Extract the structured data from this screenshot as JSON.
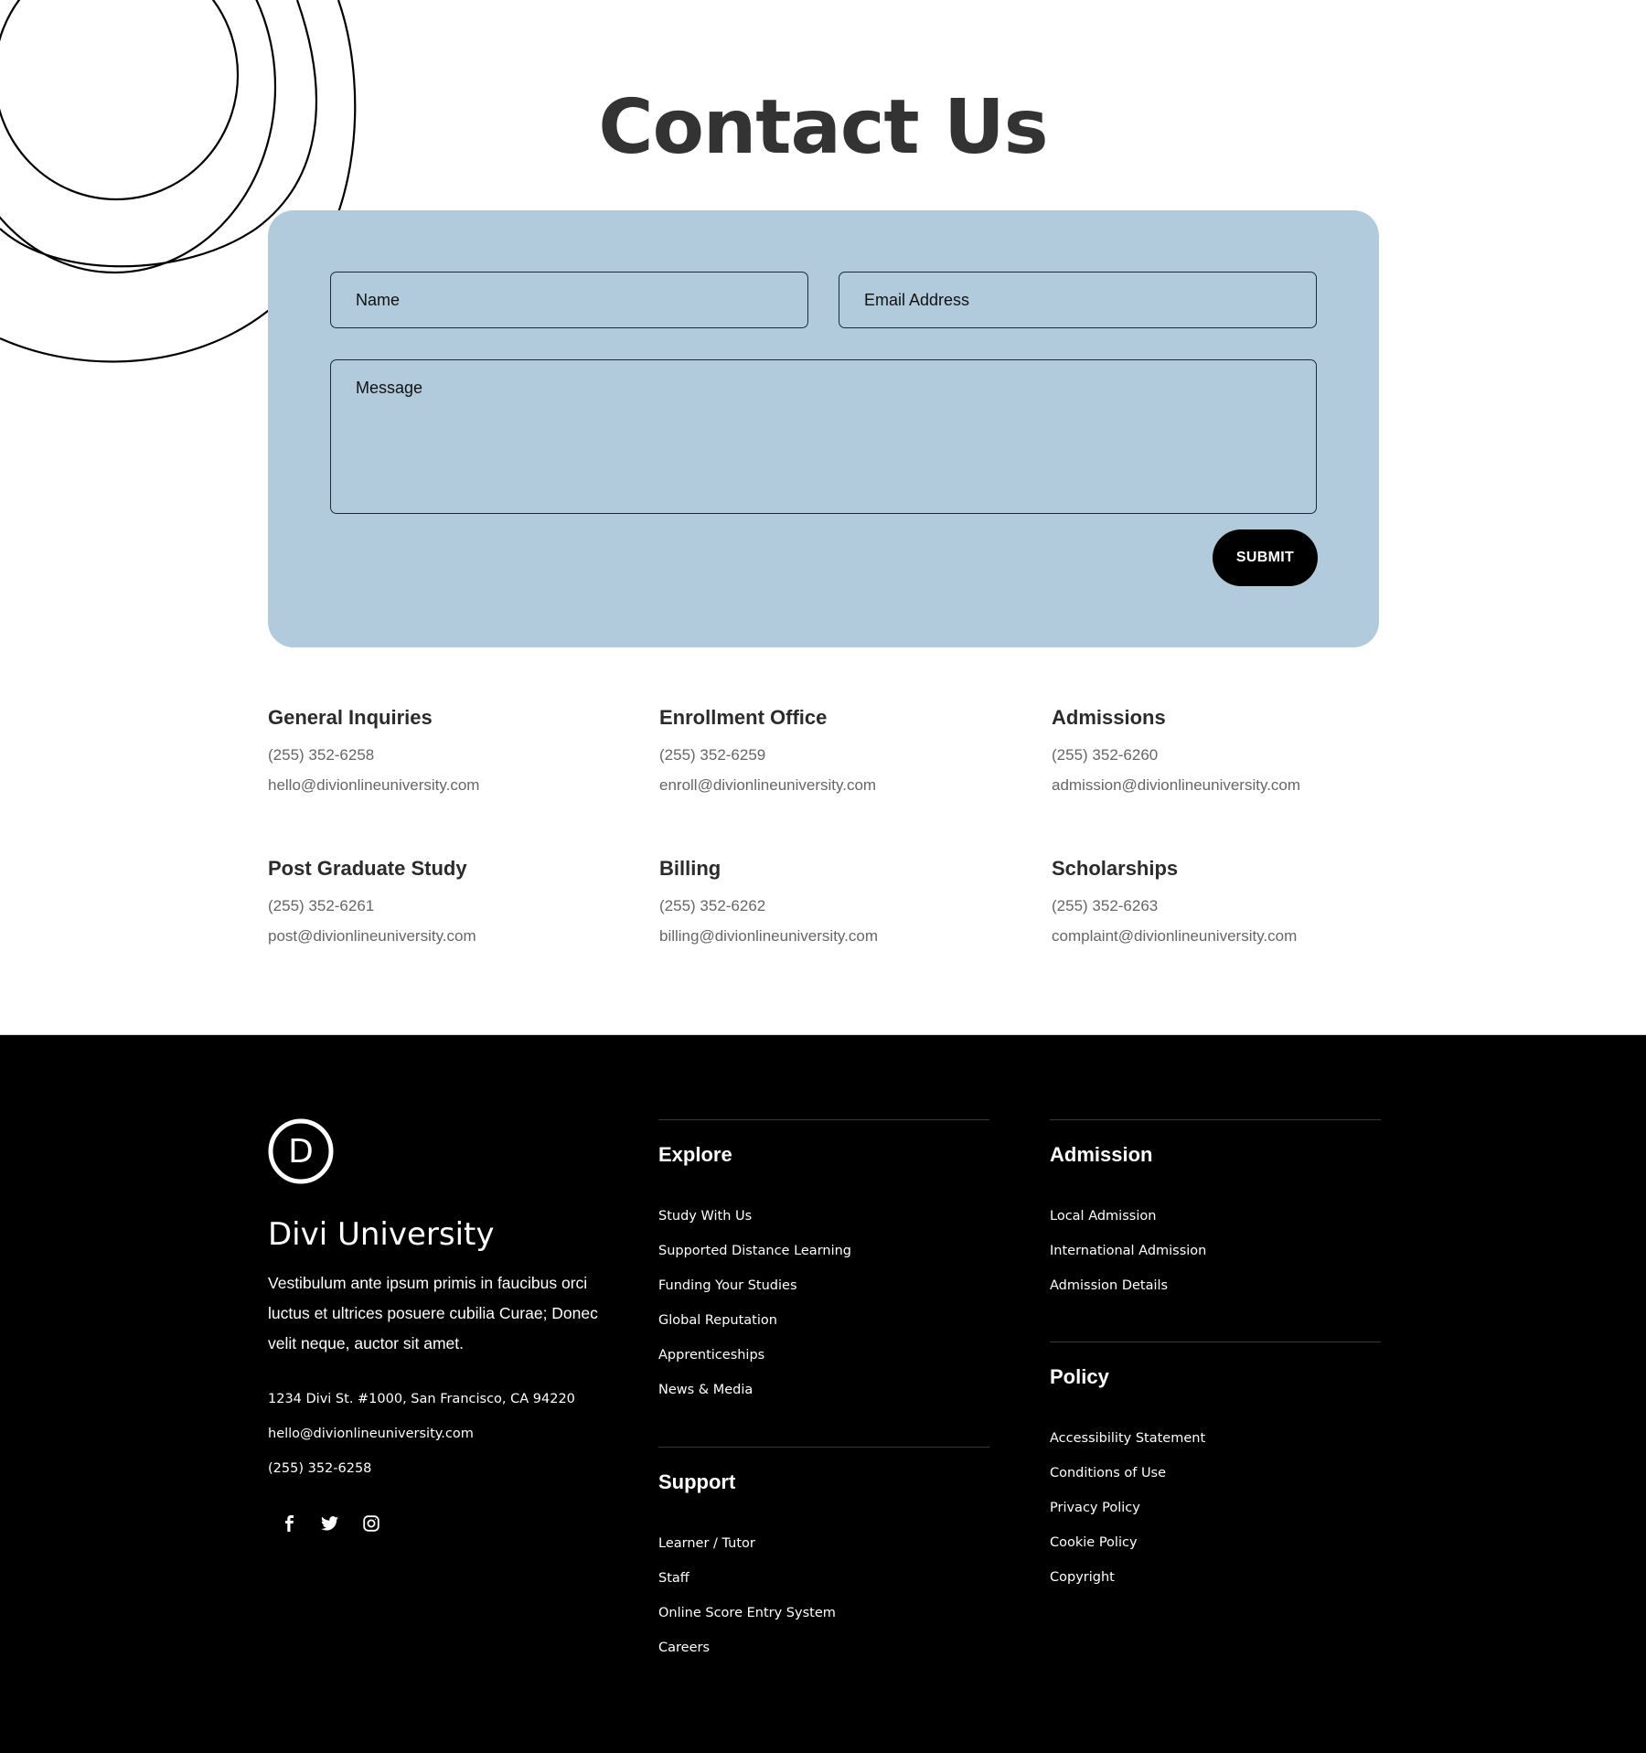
{
  "page": {
    "title": "Contact Us"
  },
  "form": {
    "name_placeholder": "Name",
    "email_placeholder": "Email Address",
    "message_placeholder": "Message",
    "name_value": "",
    "email_value": "",
    "message_value": "",
    "submit_label": "SUBMIT",
    "card_color": "#b1cbdd"
  },
  "contacts": [
    {
      "title": "General Inquiries",
      "phone": "(255) 352-6258",
      "email": "hello@divionlineuniversity.com"
    },
    {
      "title": "Enrollment Office",
      "phone": "(255) 352-6259",
      "email": "enroll@divionlineuniversity.com"
    },
    {
      "title": "Admissions",
      "phone": "(255) 352-6260",
      "email": "admission@divionlineuniversity.com"
    },
    {
      "title": "Post Graduate Study",
      "phone": "(255) 352-6261",
      "email": "post@divionlineuniversity.com"
    },
    {
      "title": "Billing",
      "phone": "(255) 352-6262",
      "email": "billing@divionlineuniversity.com"
    },
    {
      "title": "Scholarships",
      "phone": "(255) 352-6263",
      "email": "complaint@divionlineuniversity.com"
    }
  ],
  "footer": {
    "logo_letter": "D",
    "brand_name": "Divi University",
    "description": "Vestibulum ante ipsum primis in faucibus orci luctus et ultrices posuere cubilia Curae; Donec velit neque, auctor sit amet.",
    "address": "1234 Divi St. #1000, San Francisco, CA 94220",
    "email": "hello@divionlineuniversity.com",
    "phone": "(255) 352-6258",
    "socials": [
      "facebook-icon",
      "twitter-icon",
      "instagram-icon"
    ],
    "columns": {
      "explore": {
        "title": "Explore",
        "links": [
          "Study With Us",
          "Supported Distance Learning",
          "Funding Your Studies",
          "Global Reputation",
          "Apprenticeships",
          "News & Media"
        ]
      },
      "support": {
        "title": "Support",
        "links": [
          "Learner / Tutor",
          "Staff",
          "Online Score Entry System",
          "Careers"
        ]
      },
      "admission": {
        "title": "Admission",
        "links": [
          "Local Admission",
          "International Admission",
          "Admission Details"
        ]
      },
      "policy": {
        "title": "Policy",
        "links": [
          "Accessibility Statement",
          "Conditions of Use",
          "Privacy Policy",
          "Cookie Policy",
          "Copyright"
        ]
      }
    }
  }
}
